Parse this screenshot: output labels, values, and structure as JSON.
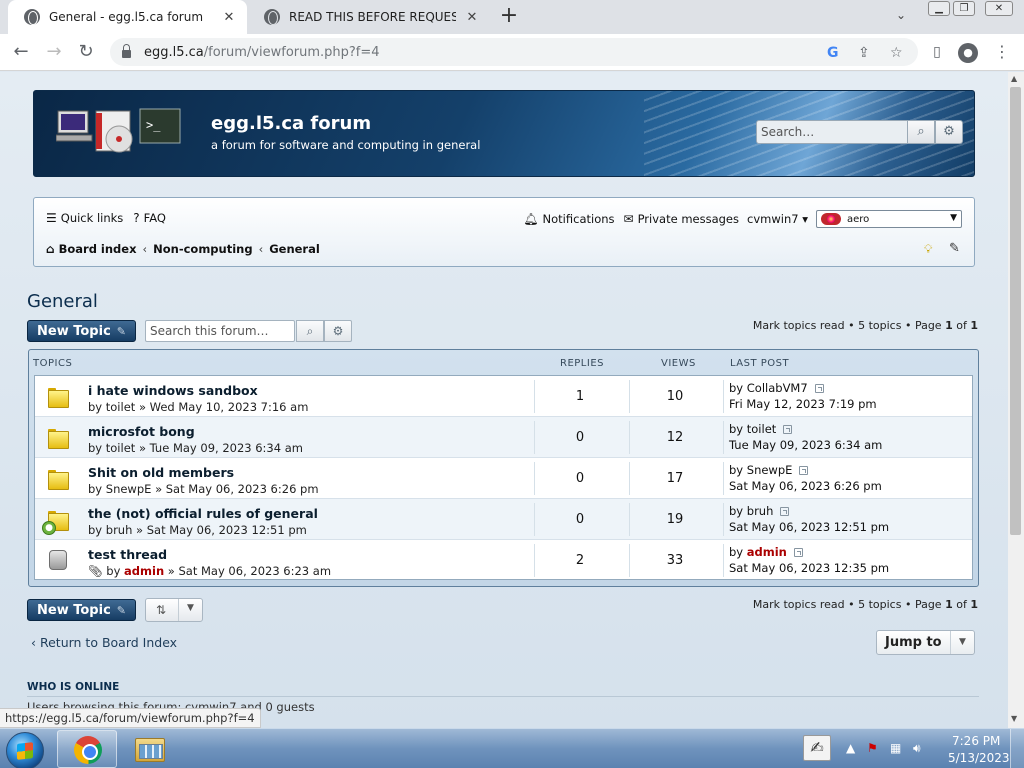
{
  "browser": {
    "tabs": [
      {
        "title": "General - egg.l5.ca forum",
        "active": true
      },
      {
        "title": "READ THIS BEFORE REQUESTING",
        "active": false
      }
    ],
    "url_host": "egg.l5.ca",
    "url_path": "/forum/viewforum.php?f=4",
    "status_url": "https://egg.l5.ca/forum/viewforum.php?f=4"
  },
  "site": {
    "title": "egg.l5.ca forum",
    "description": "a forum for software and computing in general",
    "search_placeholder": "Search…"
  },
  "nav": {
    "quick_links": "Quick links",
    "faq": "FAQ",
    "notifications": "Notifications",
    "private_messages": "Private messages",
    "username": "cvmwin7",
    "style": "aero",
    "breadcrumb": [
      "Board index",
      "Non-computing",
      "General"
    ]
  },
  "forum": {
    "title": "General",
    "new_topic": "New Topic",
    "search_placeholder": "Search this forum…",
    "mark_read": "Mark topics read",
    "topic_count": "5 topics",
    "page_label": "Page",
    "page_current": "1",
    "page_of": "of",
    "page_total": "1"
  },
  "table": {
    "headers": {
      "topics": "TOPICS",
      "replies": "REPLIES",
      "views": "VIEWS",
      "last_post": "LAST POST"
    },
    "rows": [
      {
        "title": "i hate windows sandbox",
        "by_prefix": "by",
        "author": "toilet",
        "date": "» Wed May 10, 2023 7:16 am",
        "replies": "1",
        "views": "10",
        "last_by": "CollabVM7",
        "last_date": "Fri May 12, 2023 7:19 pm"
      },
      {
        "title": "microsfot bong",
        "by_prefix": "by",
        "author": "toilet",
        "date": "» Tue May 09, 2023 6:34 am",
        "replies": "0",
        "views": "12",
        "last_by": "toilet",
        "last_date": "Tue May 09, 2023 6:34 am"
      },
      {
        "title": "Shit on old members",
        "by_prefix": "by",
        "author": "SnewpE",
        "date": "» Sat May 06, 2023 6:26 pm",
        "replies": "0",
        "views": "17",
        "last_by": "SnewpE",
        "last_date": "Sat May 06, 2023 6:26 pm"
      },
      {
        "title": "the (not) official rules of general",
        "by_prefix": "by",
        "author": "bruh",
        "date": "» Sat May 06, 2023 12:51 pm",
        "replies": "0",
        "views": "19",
        "last_by": "bruh",
        "last_date": "Sat May 06, 2023 12:51 pm"
      },
      {
        "title": "test thread",
        "by_prefix": "by",
        "author": "admin",
        "date": "» Sat May 06, 2023 6:23 am",
        "replies": "2",
        "views": "33",
        "last_by": "admin",
        "last_date": "Sat May 06, 2023 12:35 pm"
      }
    ],
    "by_word": "by"
  },
  "footer": {
    "return_link": "Return to Board Index",
    "jump_to": "Jump to",
    "who_online_heading": "WHO IS ONLINE",
    "who_online_text": "Users browsing this forum: cvmwin7 and 0 guests"
  },
  "taskbar": {
    "time": "7:26 PM",
    "date": "5/13/2023"
  }
}
